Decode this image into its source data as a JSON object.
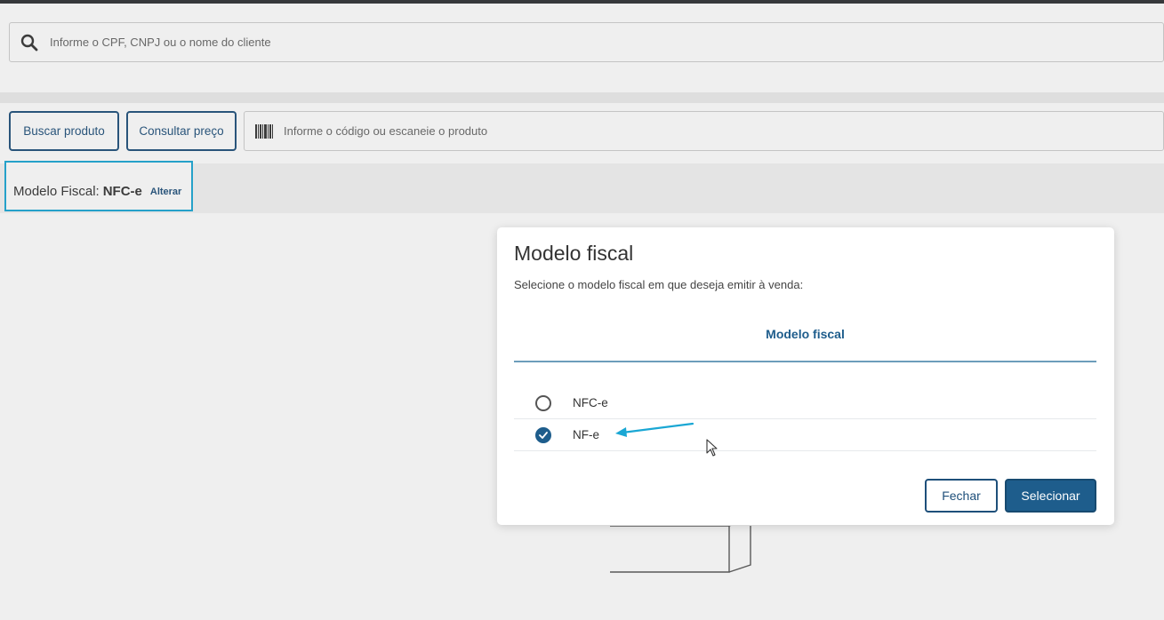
{
  "client_search": {
    "placeholder": "Informe o CPF, CNPJ ou o nome do cliente",
    "icon": "search-icon"
  },
  "product_bar": {
    "buscar_label": "Buscar produto",
    "consultar_label": "Consultar preço",
    "product_placeholder": "Informe o código ou escaneie o produto",
    "icon": "barcode-icon"
  },
  "fiscal": {
    "label": "Modelo Fiscal:",
    "value": "NFC-e",
    "change_link": "Alterar"
  },
  "modal": {
    "title": "Modelo fiscal",
    "subtitle": "Selecione o modelo fiscal em que deseja emitir à venda:",
    "tab_label": "Modelo fiscal",
    "options": [
      {
        "label": "NFC-e",
        "selected": false
      },
      {
        "label": "NF-e",
        "selected": true
      }
    ],
    "close_label": "Fechar",
    "select_label": "Selecionar"
  },
  "colors": {
    "primary": "#1e5d8c",
    "highlight": "#1aa7d4",
    "arrow": "#1aa7d4"
  }
}
